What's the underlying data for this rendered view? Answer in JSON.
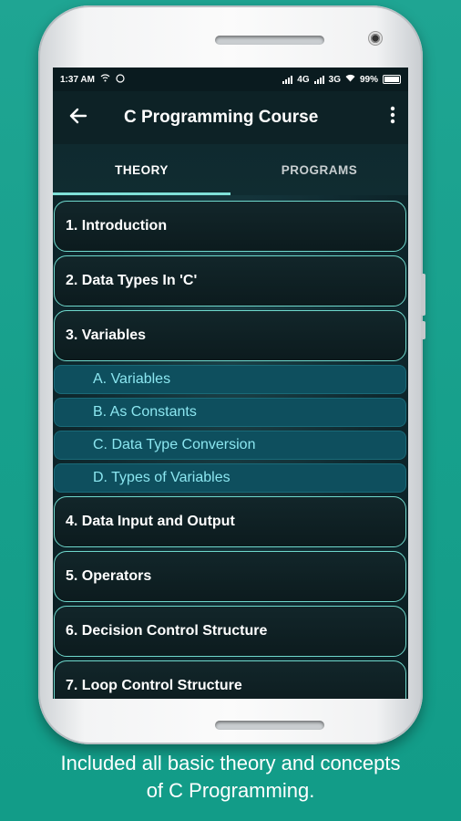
{
  "status": {
    "time": "1:37 AM",
    "network1": "4G",
    "network2": "3G",
    "battery": "99%"
  },
  "toolbar": {
    "back_icon": "arrow-back-icon",
    "title": "C Programming Course",
    "more_icon": "more-vert-icon"
  },
  "tabs": [
    {
      "label": "THEORY",
      "active": true
    },
    {
      "label": "PROGRAMS",
      "active": false
    }
  ],
  "chapters": [
    {
      "label": "1. Introduction"
    },
    {
      "label": "2. Data Types In 'C'"
    },
    {
      "label": "3. Variables"
    },
    {
      "label": "4. Data Input and Output"
    },
    {
      "label": "5. Operators"
    },
    {
      "label": "6. Decision Control Structure"
    },
    {
      "label": "7. Loop Control Structure"
    }
  ],
  "subtopics": [
    {
      "label": "A. Variables"
    },
    {
      "label": "B. As Constants"
    },
    {
      "label": "C. Data Type Conversion"
    },
    {
      "label": "D. Types of Variables"
    }
  ],
  "caption": {
    "line1": "Included all basic theory and concepts",
    "line2": "of C Programming."
  },
  "colors": {
    "background": "#17a08c",
    "accent": "#6fd8cc",
    "subtopic_bg": "#0e4f5e",
    "subtopic_text": "#8be6f0"
  }
}
